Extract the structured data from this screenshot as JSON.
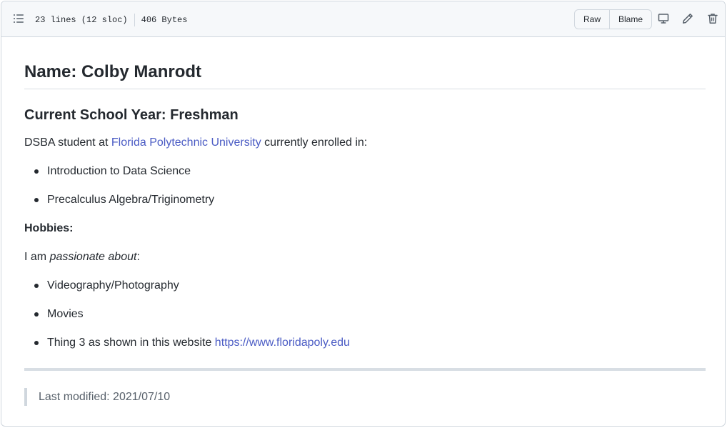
{
  "file_header": {
    "lines": "23 lines (12 sloc)",
    "size": "406 Bytes",
    "raw_label": "Raw",
    "blame_label": "Blame",
    "icons": [
      "list-unordered-icon",
      "desktop-icon",
      "pencil-icon",
      "trash-icon"
    ]
  },
  "readme": {
    "name_heading": "Name: Colby Manrodt",
    "year_heading": "Current School Year: Freshman",
    "intro_prefix": "DSBA student at ",
    "intro_link": "Florida Polytechnic University",
    "intro_suffix": " currently enrolled in:",
    "courses": [
      "Introduction to Data Science",
      "Precalculus Algebra/Triginometry"
    ],
    "hobbies_label": "Hobbies:",
    "passion_prefix": "I am ",
    "passion_em": "passionate about",
    "passion_suffix": ":",
    "hobbies": [
      "Videography/Photography",
      "Movies"
    ],
    "thing3_text": "Thing 3 as shown in this website ",
    "thing3_link": "https://www.floridapoly.edu",
    "last_modified": "Last modified: 2021/07/10"
  },
  "colors": {
    "link": "#4a5bc4",
    "header_bg": "#f6f8fa",
    "border": "#d0d7de"
  }
}
